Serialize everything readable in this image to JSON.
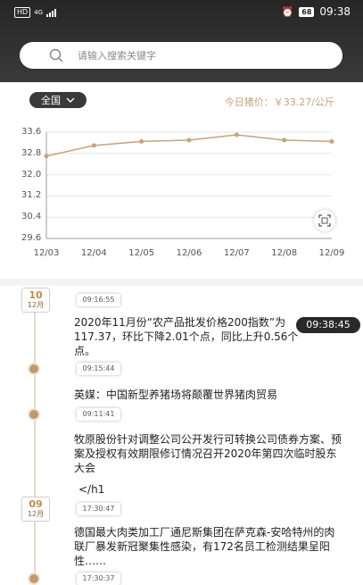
{
  "status": {
    "hd": "HD",
    "net": "4G",
    "battery": "68",
    "time": "09:38"
  },
  "search": {
    "placeholder": "请输入搜索关键字"
  },
  "filter": {
    "region": "全国"
  },
  "price_label": "今日猪价：￥33.27/公斤",
  "chart_data": {
    "type": "line",
    "categories": [
      "12/03",
      "12/04",
      "12/05",
      "12/06",
      "12/07",
      "12/08",
      "12/09"
    ],
    "values": [
      32.7,
      33.1,
      33.25,
      33.3,
      33.5,
      33.3,
      33.25
    ],
    "ylim": [
      29.6,
      33.6
    ],
    "yticks": [
      "33.6",
      "32.8",
      "32.0",
      "31.2",
      "30.4",
      "29.6"
    ],
    "line_color": "#c8a27a",
    "grid": true
  },
  "floating_time": "09:38:45",
  "timeline": {
    "dates": [
      {
        "day": "10",
        "month": "12月"
      },
      {
        "day": "09",
        "month": "12月"
      }
    ],
    "times": [
      "09:16:55",
      "09:15:44",
      "09:11:41",
      "17:30:47",
      "17:30:37"
    ],
    "news": [
      "2020年11月份“农产品批发价格200指数”为117.37，环比下降2.01个点，同比上升0.56个点。",
      "英媒：中国新型养猪场将颠覆世界猪肉贸易",
      "牧原股份针对调整公司公开发行可转换公司债券方案、预案及授权有效期限修订情况召开2020年第四次临时股东大会",
      "</h1",
      "德国最大肉类加工厂通尼斯集团在萨克森-安哈特州的肉联厂暴发新冠聚集性感染，有172名员工检测结果呈阳性……"
    ]
  }
}
